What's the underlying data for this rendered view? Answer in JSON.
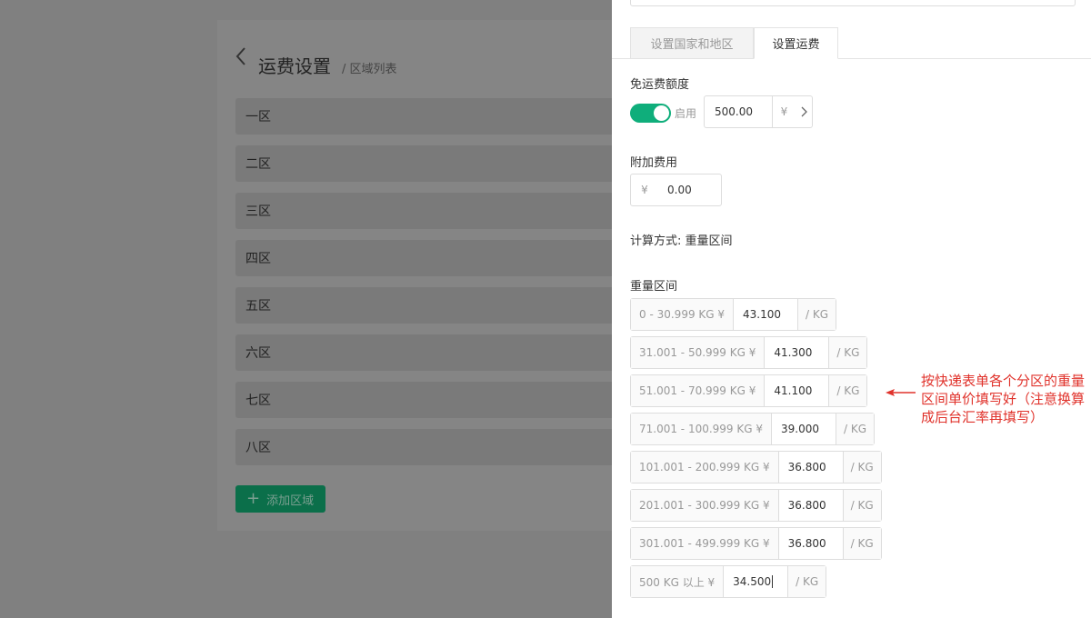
{
  "background": {
    "title": "运费设置",
    "subtitle": "/ 区域列表",
    "zones": [
      "一区",
      "二区",
      "三区",
      "四区",
      "五区",
      "六区",
      "七区",
      "八区"
    ],
    "add_zone_label": "添加区域"
  },
  "drawer": {
    "tabs": [
      {
        "label": "设置国家和地区",
        "active": false
      },
      {
        "label": "设置运费",
        "active": true
      }
    ],
    "free_shipping": {
      "label": "免运费额度",
      "toggle_on": true,
      "toggle_label": "启用",
      "value": "500.00",
      "currency": "¥"
    },
    "extra_fee": {
      "label": "附加费用",
      "currency": "¥",
      "value": "0.00"
    },
    "calc_method": "计算方式: 重量区间",
    "weight_ranges_label": "重量区间",
    "weight_ranges": [
      {
        "range": "0 - 30.999 KG ¥",
        "price": "43.100",
        "unit": "/ KG"
      },
      {
        "range": "31.001 - 50.999 KG ¥",
        "price": "41.300",
        "unit": "/ KG"
      },
      {
        "range": "51.001 - 70.999 KG ¥",
        "price": "41.100",
        "unit": "/ KG"
      },
      {
        "range": "71.001 - 100.999 KG ¥",
        "price": "39.000",
        "unit": "/ KG"
      },
      {
        "range": "101.001 - 200.999 KG ¥",
        "price": "36.800",
        "unit": "/ KG"
      },
      {
        "range": "201.001 - 300.999 KG ¥",
        "price": "36.800",
        "unit": "/ KG"
      },
      {
        "range": "301.001 - 499.999 KG ¥",
        "price": "36.800",
        "unit": "/ KG"
      },
      {
        "range": "500 KG 以上 ¥",
        "price": "34.500",
        "unit": "/ KG"
      }
    ]
  },
  "annotation": {
    "text": "按快递表单各个分区的重量区间单价填写好（注意换算成后台汇率再填写）",
    "color": "#e0322b"
  },
  "colors": {
    "accent": "#0fae7b",
    "overlay": "#808080"
  }
}
